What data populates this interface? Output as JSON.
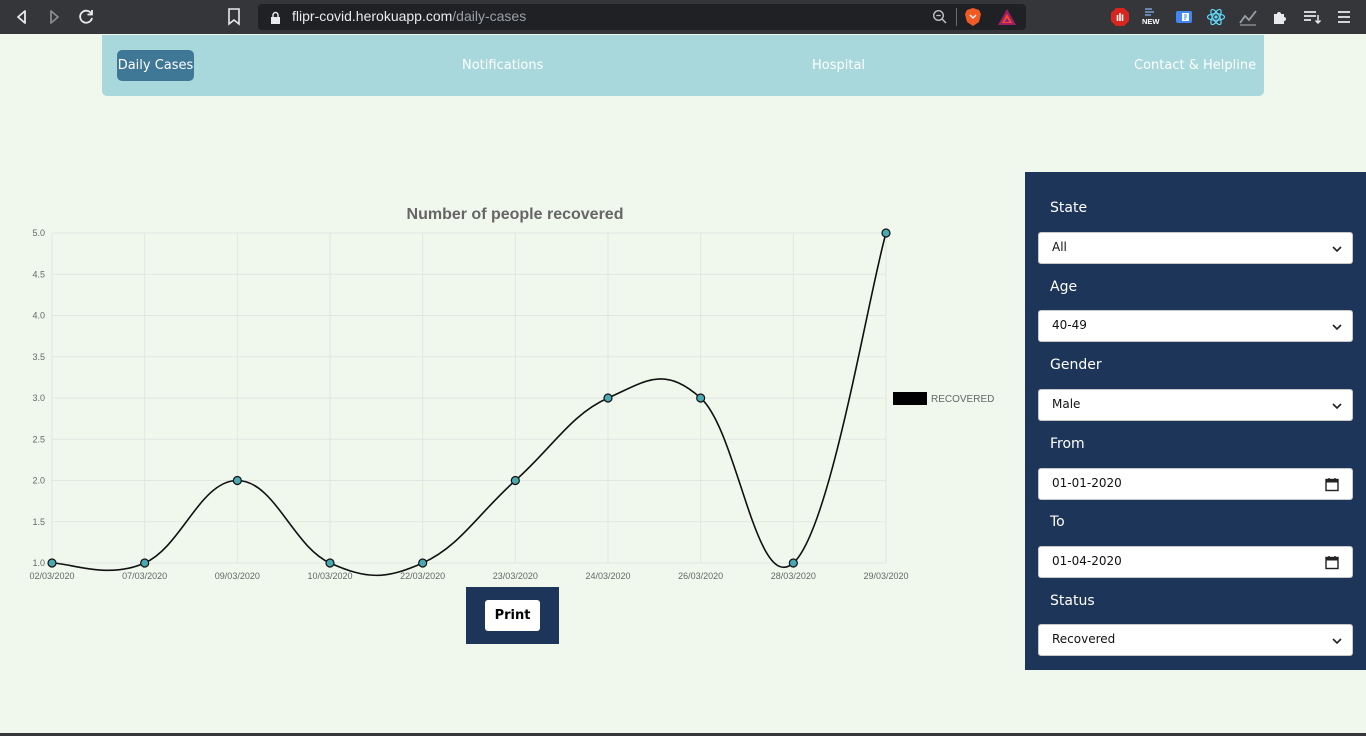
{
  "browser": {
    "url_host": "flipr-covid.herokuapp.com",
    "url_path": "/daily-cases",
    "ext_new_badge": "NEW"
  },
  "navbar": {
    "items": [
      {
        "label": "Daily Cases",
        "active": true
      },
      {
        "label": "Notifications",
        "active": false
      },
      {
        "label": "Hospital",
        "active": false
      },
      {
        "label": "Contact & Helpline",
        "active": false
      }
    ]
  },
  "chart_data": {
    "type": "line",
    "title": "Number of people recovered",
    "categories": [
      "02/03/2020",
      "07/03/2020",
      "09/03/2020",
      "10/03/2020",
      "22/03/2020",
      "23/03/2020",
      "24/03/2020",
      "26/03/2020",
      "28/03/2020",
      "29/03/2020"
    ],
    "series": [
      {
        "name": "RECOVERED",
        "values": [
          1,
          1,
          2,
          1,
          1,
          2,
          3,
          3,
          1,
          5
        ]
      }
    ],
    "ylim": [
      1,
      5
    ],
    "y_ticks": [
      "1.0",
      "1.5",
      "2.0",
      "2.5",
      "3.0",
      "3.5",
      "4.0",
      "4.5",
      "5.0"
    ],
    "y_tick_values": [
      1.0,
      1.5,
      2.0,
      2.5,
      3.0,
      3.5,
      4.0,
      4.5,
      5.0
    ],
    "grid": true,
    "legend_position": "right",
    "colors": {
      "line": "#111111",
      "point_fill": "#4aa8b0",
      "legend_swatch": "#000000"
    }
  },
  "print_label": "Print",
  "filters": {
    "state": {
      "label": "State",
      "value": "All"
    },
    "age": {
      "label": "Age",
      "value": "40-49"
    },
    "gender": {
      "label": "Gender",
      "value": "Male"
    },
    "from": {
      "label": "From",
      "value": "01-01-2020"
    },
    "to": {
      "label": "To",
      "value": "01-04-2020"
    },
    "status": {
      "label": "Status",
      "value": "Recovered"
    }
  },
  "colors": {
    "navbar": "#a8d8db",
    "nav_active": "#3f7896",
    "panel": "#1d3558",
    "background": "#f0f8ee"
  }
}
